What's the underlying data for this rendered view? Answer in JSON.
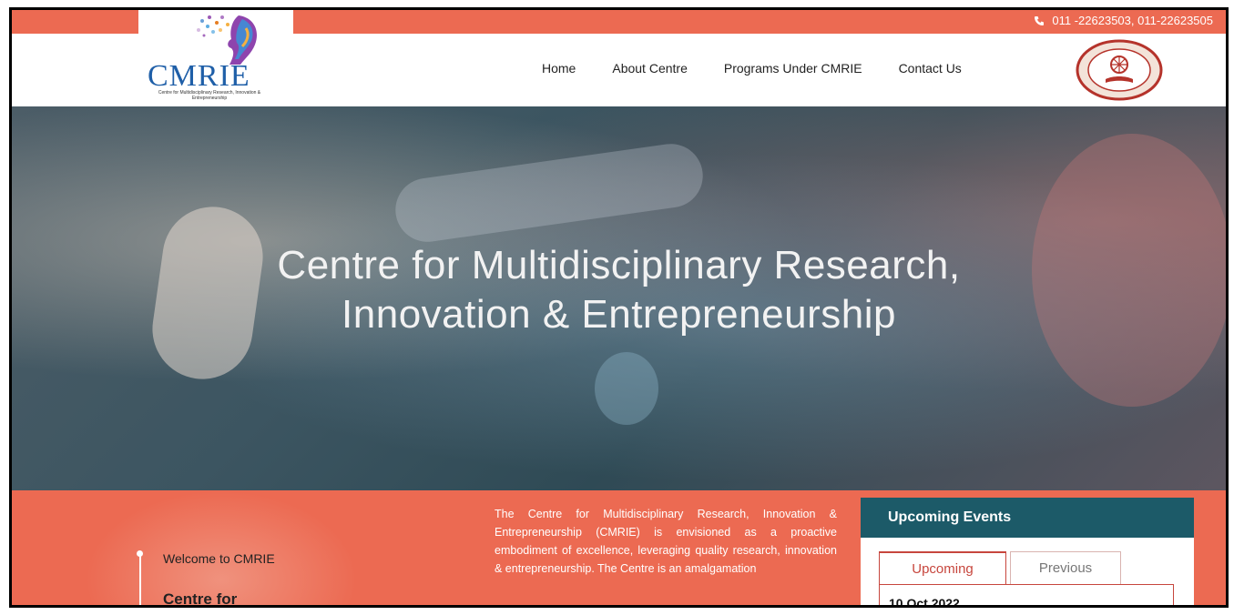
{
  "topbar": {
    "phone": "011 -22623503, 011-22623505",
    "phone_icon": "phone-icon"
  },
  "header": {
    "logo_text": "CMRIE",
    "logo_subtitle": "Centre for Multidisciplinary Research, Innovation & Entrepreneurship",
    "nav": [
      {
        "label": "Home"
      },
      {
        "label": "About Centre"
      },
      {
        "label": "Programs Under CMRIE"
      },
      {
        "label": "Contact Us"
      }
    ],
    "seal_icon": "university-seal-icon"
  },
  "hero": {
    "title_line1": "Centre for Multidisciplinary Research,",
    "title_line2": "Innovation & Entrepreneurship"
  },
  "about": {
    "welcome": "Welcome to CMRIE",
    "heading": "Centre for",
    "intro": "The Centre for Multidisciplinary Research, Innovation & Entrepreneurship (CMRIE) is envisioned as a proactive embodiment of excellence, leveraging quality research, innovation & entrepreneurship. The Centre is an amalgamation"
  },
  "events": {
    "title": "Upcoming Events",
    "tabs": [
      {
        "label": "Upcoming"
      },
      {
        "label": "Previous"
      }
    ],
    "first_date": "10 Oct 2022"
  },
  "colors": {
    "accent": "#ec6a52",
    "events_header": "#1c5a68",
    "logo_blue": "#1f5fa8"
  }
}
